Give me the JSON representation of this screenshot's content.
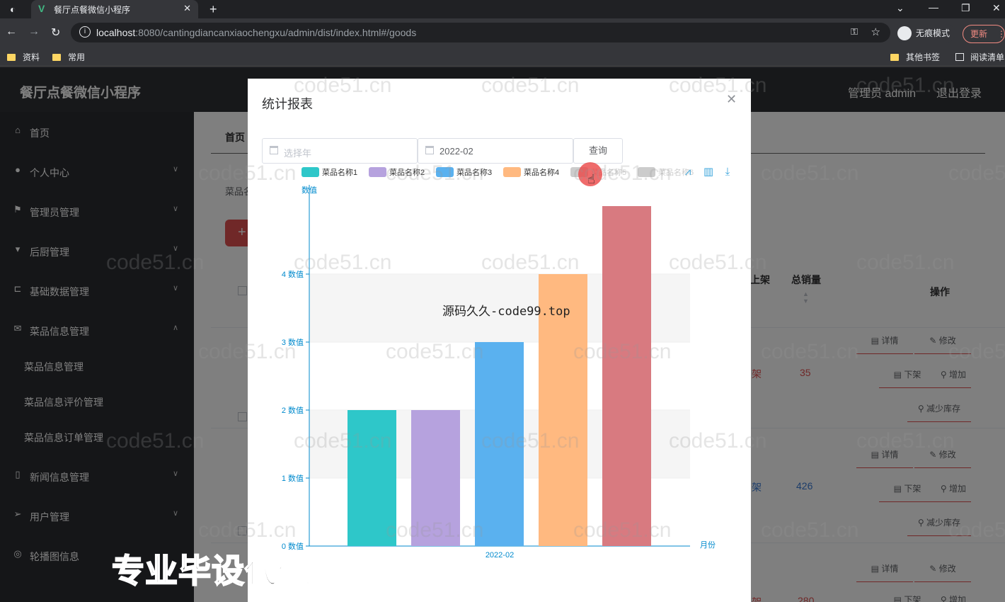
{
  "browser": {
    "tab_title": "餐厅点餐微信小程序",
    "url_host": "localhost",
    "url_rest": ":8080/cantingdiancanxiaochengxu/admin/dist/index.html#/goods",
    "incognito_label": "无痕模式",
    "update_label": "更新",
    "bookmarks": [
      "资料",
      "常用",
      "其他书签",
      "阅读清单"
    ]
  },
  "app": {
    "title": "餐厅点餐微信小程序",
    "admin_label": "管理员 admin",
    "logout_label": "退出登录"
  },
  "sidebar": {
    "items": [
      {
        "label": "首页",
        "icon": "home-icon"
      },
      {
        "label": "个人中心",
        "icon": "user-icon"
      },
      {
        "label": "管理员管理",
        "icon": "flag-icon"
      },
      {
        "label": "后厨管理",
        "icon": "chef-icon"
      },
      {
        "label": "基础数据管理",
        "icon": "crop-icon"
      },
      {
        "label": "菜品信息管理",
        "icon": "mail-icon"
      },
      {
        "label": "新闻信息管理",
        "icon": "mic-icon"
      },
      {
        "label": "用户管理",
        "icon": "send-icon"
      },
      {
        "label": "轮播图信息",
        "icon": "compass-icon"
      }
    ],
    "subitems": [
      "菜品信息管理",
      "菜品信息评价管理",
      "菜品信息订单管理"
    ]
  },
  "main": {
    "breadcrumb": "首页",
    "filter_label": "菜品名",
    "add_label": "+",
    "columns": {
      "shelf": "上架",
      "sales": "总销量",
      "ops": "操作"
    },
    "rows": [
      {
        "status": "架",
        "sales": "35"
      },
      {
        "status": "架",
        "sales": "426"
      },
      {
        "status": "架",
        "sales": "280"
      }
    ],
    "ops": {
      "detail": "详情",
      "edit": "修改",
      "offshelf": "下架",
      "add_stock": "增加",
      "reduce_stock": "减少库存"
    }
  },
  "dialog": {
    "title": "统计报表",
    "year_placeholder": "选择年",
    "month_value": "2022-02",
    "query_label": "查询",
    "watermark": "源码久久-code99.top"
  },
  "chart_data": {
    "type": "bar",
    "categories": [
      "2022-02"
    ],
    "series": [
      {
        "name": "菜品名称1",
        "values": [
          2
        ],
        "color": "#2ec7c9",
        "visible": true
      },
      {
        "name": "菜品名称2",
        "values": [
          2
        ],
        "color": "#b6a2de",
        "visible": true
      },
      {
        "name": "菜品名称3",
        "values": [
          3
        ],
        "color": "#5ab1ef",
        "visible": true
      },
      {
        "name": "菜品名称4",
        "values": [
          4
        ],
        "color": "#ffb980",
        "visible": true
      },
      {
        "name": "菜品名称5",
        "values": [
          null
        ],
        "color": "#d87a80",
        "visible": false
      },
      {
        "name": "菜品名称6",
        "values": [
          5
        ],
        "color": "#d87a80",
        "visible": false
      }
    ],
    "bar_values": [
      2,
      2,
      3,
      4,
      5
    ],
    "bar_colors": [
      "#2ec7c9",
      "#b6a2de",
      "#5ab1ef",
      "#ffb980",
      "#d87a80"
    ],
    "ylabel": "数值",
    "xlabel": "月份",
    "ytick_suffix": "数值",
    "ylim": [
      0,
      5
    ],
    "yticks": [
      0,
      1,
      2,
      3,
      4
    ],
    "grid": true,
    "legend_position": "top"
  },
  "overlay": {
    "watermark": "code51.cn",
    "promo": "专业毕设代做"
  }
}
